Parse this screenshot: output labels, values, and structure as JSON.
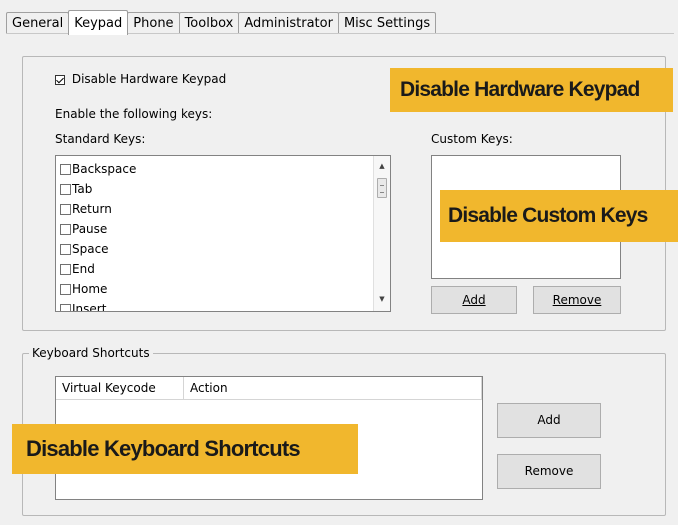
{
  "tabs": [
    {
      "label": "General"
    },
    {
      "label": "Keypad"
    },
    {
      "label": "Phone"
    },
    {
      "label": "Toolbox"
    },
    {
      "label": "Administrator"
    },
    {
      "label": "Misc Settings"
    }
  ],
  "keypad": {
    "disable_hw_keypad": {
      "label": "Disable Hardware Keypad",
      "checked": true
    },
    "enable_keys_label": "Enable the following keys:",
    "standard_keys_label": "Standard Keys:",
    "custom_keys_label": "Custom Keys:",
    "standard_keys": [
      {
        "label": "Backspace",
        "checked": false
      },
      {
        "label": "Tab",
        "checked": false
      },
      {
        "label": "Return",
        "checked": false
      },
      {
        "label": "Pause",
        "checked": false
      },
      {
        "label": "Space",
        "checked": false
      },
      {
        "label": "End",
        "checked": false
      },
      {
        "label": "Home",
        "checked": false
      },
      {
        "label": "Insert",
        "checked": false
      }
    ],
    "add_label": "Add",
    "remove_label": "Remove"
  },
  "shortcuts": {
    "group_title": "Keyboard Shortcuts",
    "col_virtual_keycode": "Virtual Keycode",
    "col_action": "Action",
    "add_label": "Add",
    "remove_label": "Remove"
  },
  "banners": {
    "hardware": "Disable Hardware Keypad",
    "custom": "Disable Custom Keys",
    "shortcuts": "Disable Keyboard Shortcuts"
  },
  "colors": {
    "banner": "#f1b72d"
  }
}
